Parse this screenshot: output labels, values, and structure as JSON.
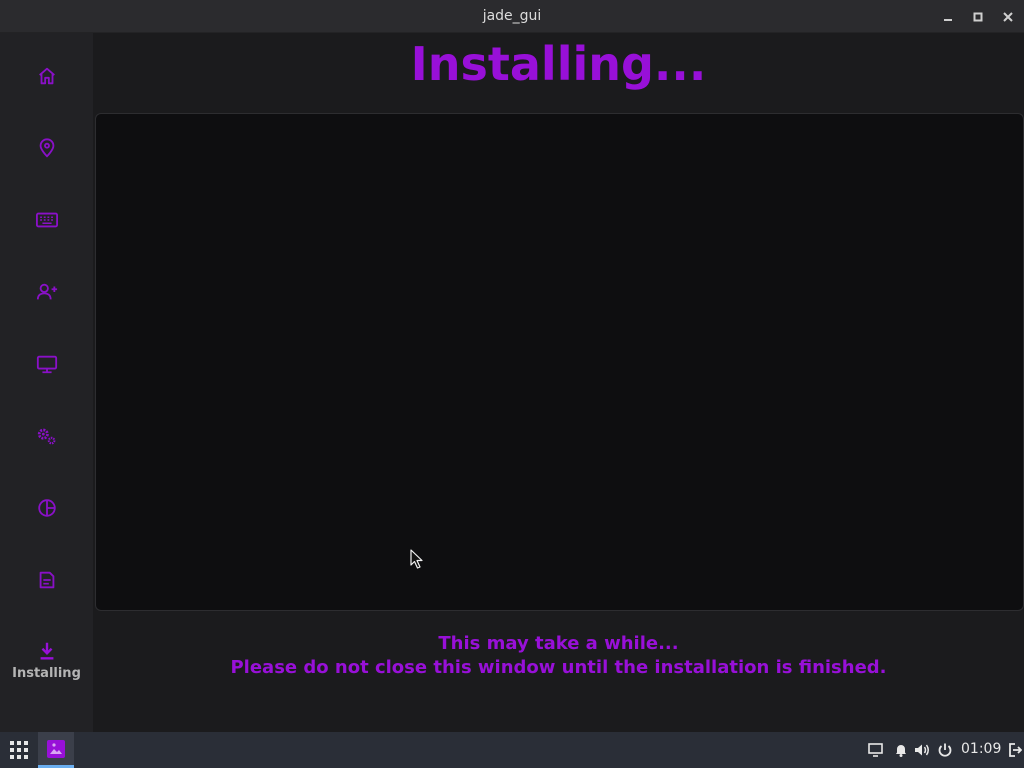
{
  "window": {
    "title": "jade_gui"
  },
  "sidebar": {
    "items": [
      {
        "icon": "home-icon",
        "label": ""
      },
      {
        "icon": "location-pin-icon",
        "label": ""
      },
      {
        "icon": "keyboard-icon",
        "label": ""
      },
      {
        "icon": "add-user-icon",
        "label": ""
      },
      {
        "icon": "monitor-icon",
        "label": ""
      },
      {
        "icon": "settings-gears-icon",
        "label": ""
      },
      {
        "icon": "partition-pie-icon",
        "label": ""
      },
      {
        "icon": "summary-document-icon",
        "label": ""
      },
      {
        "icon": "download-icon",
        "label": "Installing"
      }
    ],
    "accent": "#9810d8"
  },
  "main": {
    "heading": "Installing...",
    "message_line1": "This may take a while...",
    "message_line2": "Please do not close this window until the installation is finished."
  },
  "taskbar": {
    "clock": "01:09",
    "tray_icons": [
      "display-icon",
      "bell-icon",
      "volume-icon",
      "power-icon",
      "logout-icon"
    ]
  }
}
